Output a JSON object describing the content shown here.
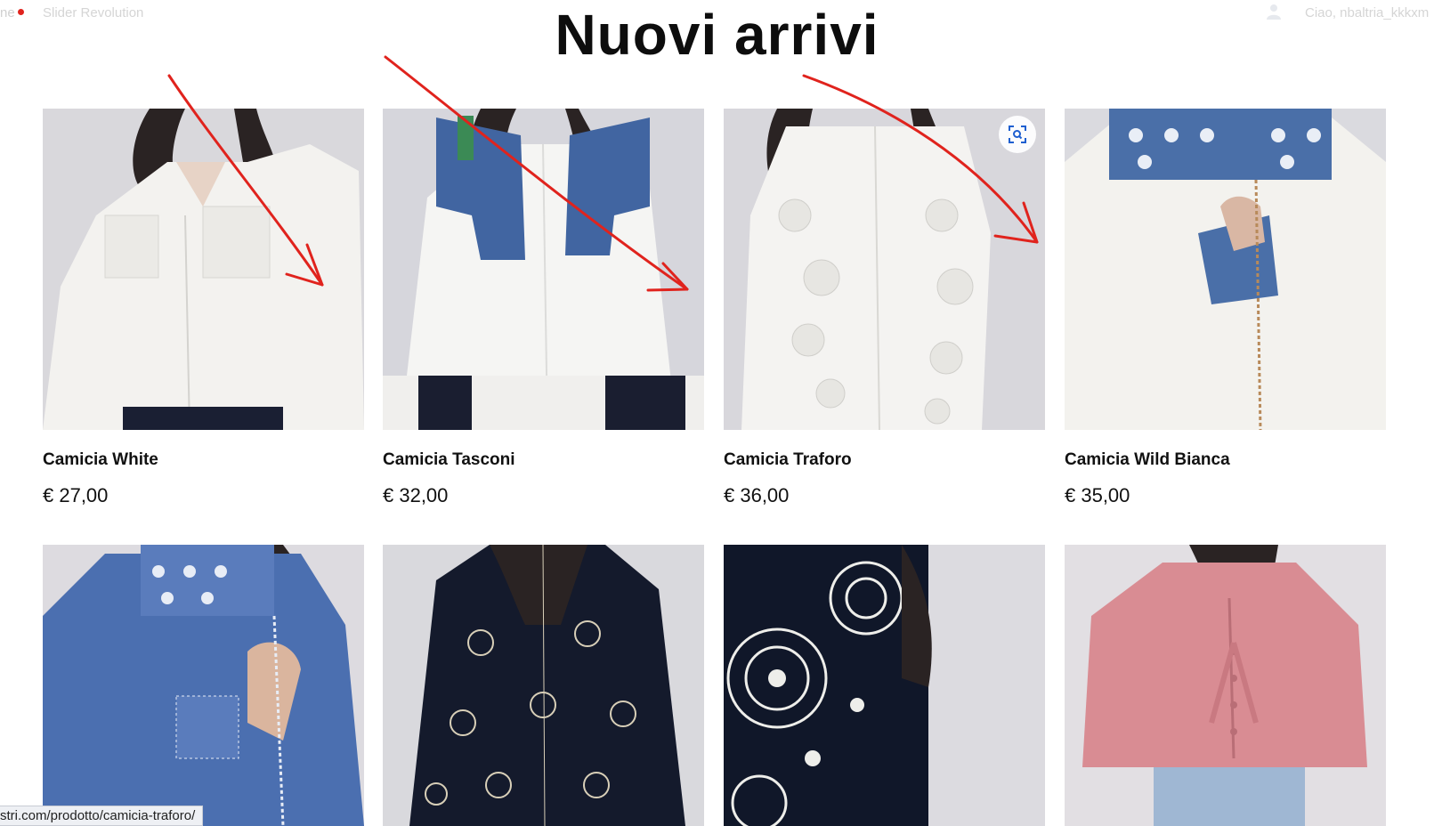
{
  "admin_bar": {
    "home_fragment": "ne",
    "slider_label": "Slider Revolution",
    "greeting": "Ciao, nbaltria_kkkxm"
  },
  "section_title": "Nuovi arrivi",
  "products": [
    {
      "name": "Camicia White",
      "price": "€ 27,00"
    },
    {
      "name": "Camicia Tasconi",
      "price": "€ 32,00"
    },
    {
      "name": "Camicia Traforo",
      "price": "€ 36,00"
    },
    {
      "name": "Camicia Wild Bianca",
      "price": "€ 35,00"
    },
    {
      "name": "",
      "price": ""
    },
    {
      "name": "",
      "price": ""
    },
    {
      "name": "",
      "price": ""
    },
    {
      "name": "",
      "price": ""
    }
  ],
  "status_bar": {
    "url": "stri.com/prodotto/camicia-traforo/"
  },
  "colors": {
    "annotation_red": "#e0231d",
    "photo_background": "#dcdbe0",
    "denim": "#3f5f9a",
    "navy": "#141c2e",
    "pink": "#d98c93"
  },
  "icons": [
    "user-icon",
    "zoom-icon",
    "annotation-arrow"
  ]
}
